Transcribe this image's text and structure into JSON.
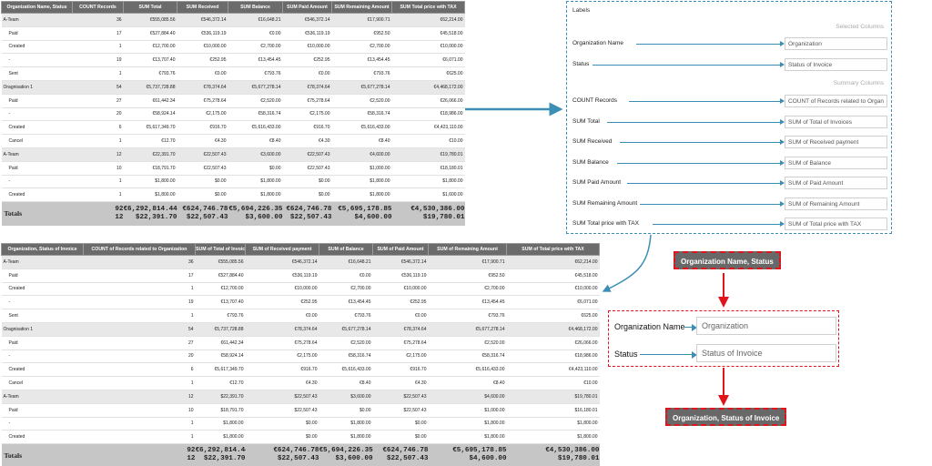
{
  "colors": {
    "header_bg": "#6b6b6b",
    "group_bg": "#e8e8e8",
    "total_bg": "#c6c6c6",
    "accent_blue": "#3c8fb4",
    "accent_red": "#e1141c"
  },
  "top_table": {
    "headers": [
      "Organization Name, Status",
      "COUNT Records",
      "SUM Total",
      "SUM Received",
      "SUM Balance",
      "SUM Paid Amount",
      "SUM Remaining Amount",
      "SUM Total price with TAX"
    ],
    "rows": [
      {
        "kind": "grp",
        "cells": [
          "A-Team",
          "36",
          "€555,085.56",
          "€546,372.14",
          "€16,648.21",
          "€546,372.14",
          "€17,900.71",
          "€62,214.00"
        ]
      },
      {
        "kind": "sub",
        "cells": [
          "Paid",
          "17",
          "€527,884.40",
          "€536,119.19",
          "€0.00",
          "€536,119.19",
          "€952.50",
          "€45,518.00"
        ]
      },
      {
        "kind": "sub",
        "cells": [
          "Created",
          "1",
          "€12,700.00",
          "€10,000.00",
          "€2,700.00",
          "€10,000.00",
          "€2,700.00",
          "€10,000.00"
        ]
      },
      {
        "kind": "sub",
        "cells": [
          "-",
          "19",
          "€13,707.40",
          "€252.95",
          "€13,454.45",
          "€252.95",
          "€13,454.45",
          "€6,071.00"
        ]
      },
      {
        "kind": "sub",
        "cells": [
          "Sent",
          "1",
          "€793.76",
          "€0.00",
          "€793.76",
          "€0.00",
          "€793.76",
          "€625.00"
        ]
      },
      {
        "kind": "grp",
        "cells": [
          "Oragnisation 1",
          "54",
          "€5,737,728.88",
          "€78,374.64",
          "€5,677,278.14",
          "€78,374.64",
          "€5,677,278.14",
          "€4,468,172.00"
        ]
      },
      {
        "kind": "sub",
        "cells": [
          "Paid",
          "27",
          "€61,442.34",
          "€75,278.64",
          "€2,520.00",
          "€75,278.64",
          "€2,520.00",
          "€26,066.00"
        ]
      },
      {
        "kind": "sub",
        "cells": [
          "-",
          "20",
          "€58,924.14",
          "€2,175.00",
          "€58,316.74",
          "€2,175.00",
          "€58,316.74",
          "€18,986.00"
        ]
      },
      {
        "kind": "sub",
        "cells": [
          "Created",
          "6",
          "€5,617,349.70",
          "€916.70",
          "€5,616,433.00",
          "€916.70",
          "€5,616,433.00",
          "€4,423,110.00"
        ]
      },
      {
        "kind": "sub",
        "cells": [
          "Cancel",
          "1",
          "€12.70",
          "€4.30",
          "€8.40",
          "€4.30",
          "€8.40",
          "€10.00"
        ]
      },
      {
        "kind": "grp",
        "cells": [
          "A-Team",
          "12",
          "€22,391.70",
          "€22,507.43",
          "€3,600.00",
          "€22,507.43",
          "€4,600.00",
          "€19,780.01"
        ]
      },
      {
        "kind": "sub",
        "cells": [
          "Paid",
          "10",
          "€18,791.70",
          "€22,507.43",
          "$0.00",
          "€22,507.43",
          "$1,000.00",
          "€18,180.01"
        ]
      },
      {
        "kind": "sub",
        "cells": [
          "-",
          "1",
          "$1,800.00",
          "$0.00",
          "$1,800.00",
          "$0.00",
          "$1,800.00",
          "$1,800.00"
        ]
      },
      {
        "kind": "sub",
        "cells": [
          "Created",
          "1",
          "$1,800.00",
          "$0.00",
          "$1,800.00",
          "$0.00",
          "$1,800.00",
          "$1,600.00"
        ]
      }
    ],
    "totals": {
      "label": "Totals",
      "line1": [
        "92",
        "€6,292,814.44",
        "€624,746.78",
        "€5,694,226.35",
        "€624,746.78",
        "€5,695,178.85",
        "€4,530,386.00"
      ],
      "line2": [
        "12",
        "$22,391.70",
        "$22,507.43",
        "$3,600.00",
        "$22,507.43",
        "$4,600.00",
        "$19,780.01"
      ]
    }
  },
  "labels_panel": {
    "title": "Labels",
    "selected_heading": "Selected Columns",
    "summary_heading": "Summary Columns",
    "selected": [
      {
        "name": "Organization Name",
        "value": "Organization"
      },
      {
        "name": "Status",
        "value": "Status of Invoice"
      }
    ],
    "summary": [
      {
        "name": "COUNT Records",
        "value": "COUNT of Records related to Organ"
      },
      {
        "name": "SUM Total",
        "value": "SUM of Total of Invoices"
      },
      {
        "name": "SUM Received",
        "value": "SUM of Received payment"
      },
      {
        "name": "SUM Balance",
        "value": "SUM of Balance"
      },
      {
        "name": "SUM Paid Amount",
        "value": "SUM of Paid Amount"
      },
      {
        "name": "SUM Remaining Amount",
        "value": "SUM of Remaining Amount"
      },
      {
        "name": "SUM Total price with TAX",
        "value": "SUM of Total price with TAX"
      }
    ]
  },
  "bottom_table": {
    "headers": [
      "Organization, Status of Invoice",
      "COUNT of Records related to Organization",
      "SUM of Total of Invoices",
      "SUM of Received payment",
      "SUM of Balance",
      "SUM of Paid Amount",
      "SUM of Remaining Amount",
      "SUM of Total price with TAX"
    ],
    "rows": [
      {
        "kind": "grp",
        "cells": [
          "A-Team",
          "36",
          "€555,085.56",
          "€546,372.14",
          "€16,648.21",
          "€546,372.14",
          "€17,900.71",
          "€62,214.00"
        ]
      },
      {
        "kind": "sub",
        "cells": [
          "Paid",
          "17",
          "€527,884.40",
          "€536,119.19",
          "€0.00",
          "€536,119.19",
          "€952.50",
          "€45,518.00"
        ]
      },
      {
        "kind": "sub",
        "cells": [
          "Created",
          "1",
          "€12,700.00",
          "€10,000.00",
          "€2,700.00",
          "€10,000.00",
          "€2,700.00",
          "€10,000.00"
        ]
      },
      {
        "kind": "sub",
        "cells": [
          "-",
          "19",
          "€13,707.40",
          "€252.95",
          "€13,454.45",
          "€252.95",
          "€13,454.45",
          "€6,071.00"
        ]
      },
      {
        "kind": "sub",
        "cells": [
          "Sent",
          "1",
          "€793.76",
          "€0.00",
          "€793.76",
          "€0.00",
          "€793.76",
          "€625.00"
        ]
      },
      {
        "kind": "grp",
        "cells": [
          "Oragnisation 1",
          "54",
          "€5,737,728.88",
          "€78,374.64",
          "€5,677,278.14",
          "€78,374.64",
          "€5,677,278.14",
          "€4,468,172.00"
        ]
      },
      {
        "kind": "sub",
        "cells": [
          "Paid",
          "27",
          "€61,442.34",
          "€75,278.64",
          "€2,520.00",
          "€75,278.64",
          "€2,520.00",
          "€26,066.00"
        ]
      },
      {
        "kind": "sub",
        "cells": [
          "-",
          "20",
          "€58,924.14",
          "€2,175.00",
          "€58,316.74",
          "€2,175.00",
          "€58,316.74",
          "€18,986.00"
        ]
      },
      {
        "kind": "sub",
        "cells": [
          "Created",
          "6",
          "€5,617,349.70",
          "€916.70",
          "€5,616,433.00",
          "€916.70",
          "€5,616,433.00",
          "€4,423,110.00"
        ]
      },
      {
        "kind": "sub",
        "cells": [
          "Cancel",
          "1",
          "€12.70",
          "€4.30",
          "€8.40",
          "€4.30",
          "€8.40",
          "€10.00"
        ]
      },
      {
        "kind": "grp",
        "cells": [
          "A-Team",
          "12",
          "$22,391.70",
          "$22,507.43",
          "$3,600.00",
          "$22,507.43",
          "$4,600.00",
          "$19,780.01"
        ]
      },
      {
        "kind": "sub",
        "cells": [
          "Paid",
          "10",
          "$18,791.70",
          "$22,507.43",
          "$0.00",
          "$22,507.43",
          "$1,000.00",
          "$16,180.01"
        ]
      },
      {
        "kind": "sub",
        "cells": [
          "-",
          "1",
          "$1,800.00",
          "$0.00",
          "$1,800.00",
          "$0.00",
          "$1,800.00",
          "$1,800.00"
        ]
      },
      {
        "kind": "sub",
        "cells": [
          "Created",
          "1",
          "$1,800.00",
          "$0.00",
          "$1,800.00",
          "$0.00",
          "$1,800.00",
          "$1,800.00"
        ]
      }
    ],
    "totals": {
      "label": "Totals",
      "line1": [
        "92",
        "€6,292,814.44",
        "€624,746.78",
        "€5,694,226.35",
        "€624,746.78",
        "€5,695,178.85",
        "€4,530,386.00"
      ],
      "line2": [
        "12",
        "$22,391.70",
        "$22,507.43",
        "$3,600.00",
        "$22,507.43",
        "$4,600.00",
        "$19,780.01"
      ]
    }
  },
  "flow": {
    "before_label": "Organization Name, Status",
    "after_label": "Organization, Status of Invoice",
    "rows": [
      {
        "name": "Organization Name",
        "value": "Organization"
      },
      {
        "name": "Status",
        "value": "Status of Invoice"
      }
    ]
  }
}
